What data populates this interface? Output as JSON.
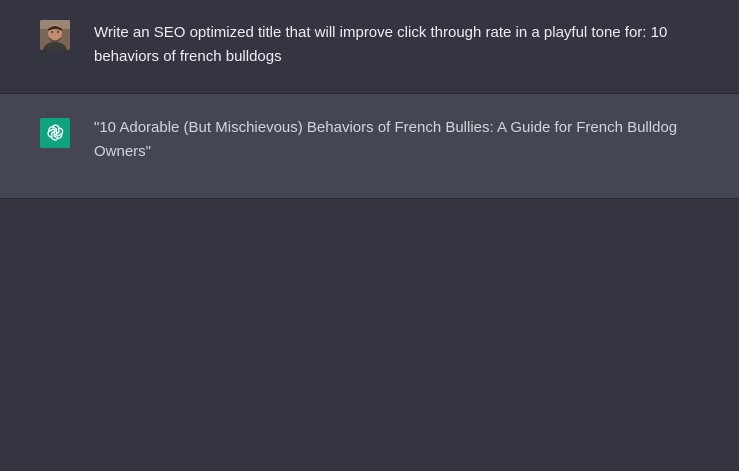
{
  "conversation": {
    "messages": [
      {
        "role": "user",
        "avatar": "user-photo-avatar",
        "text": "Write an SEO optimized title that will improve click through rate in a playful tone for: 10 behaviors of french bulldogs"
      },
      {
        "role": "assistant",
        "avatar": "chatgpt-logo-icon",
        "text": "\"10 Adorable (But Mischievous) Behaviors of French Bullies: A Guide for French Bulldog Owners\""
      }
    ]
  },
  "colors": {
    "background": "#343541",
    "assistant_row": "#444654",
    "logo_green": "#10a37f",
    "user_text": "#ececf1",
    "assistant_text": "#d1d5db"
  }
}
